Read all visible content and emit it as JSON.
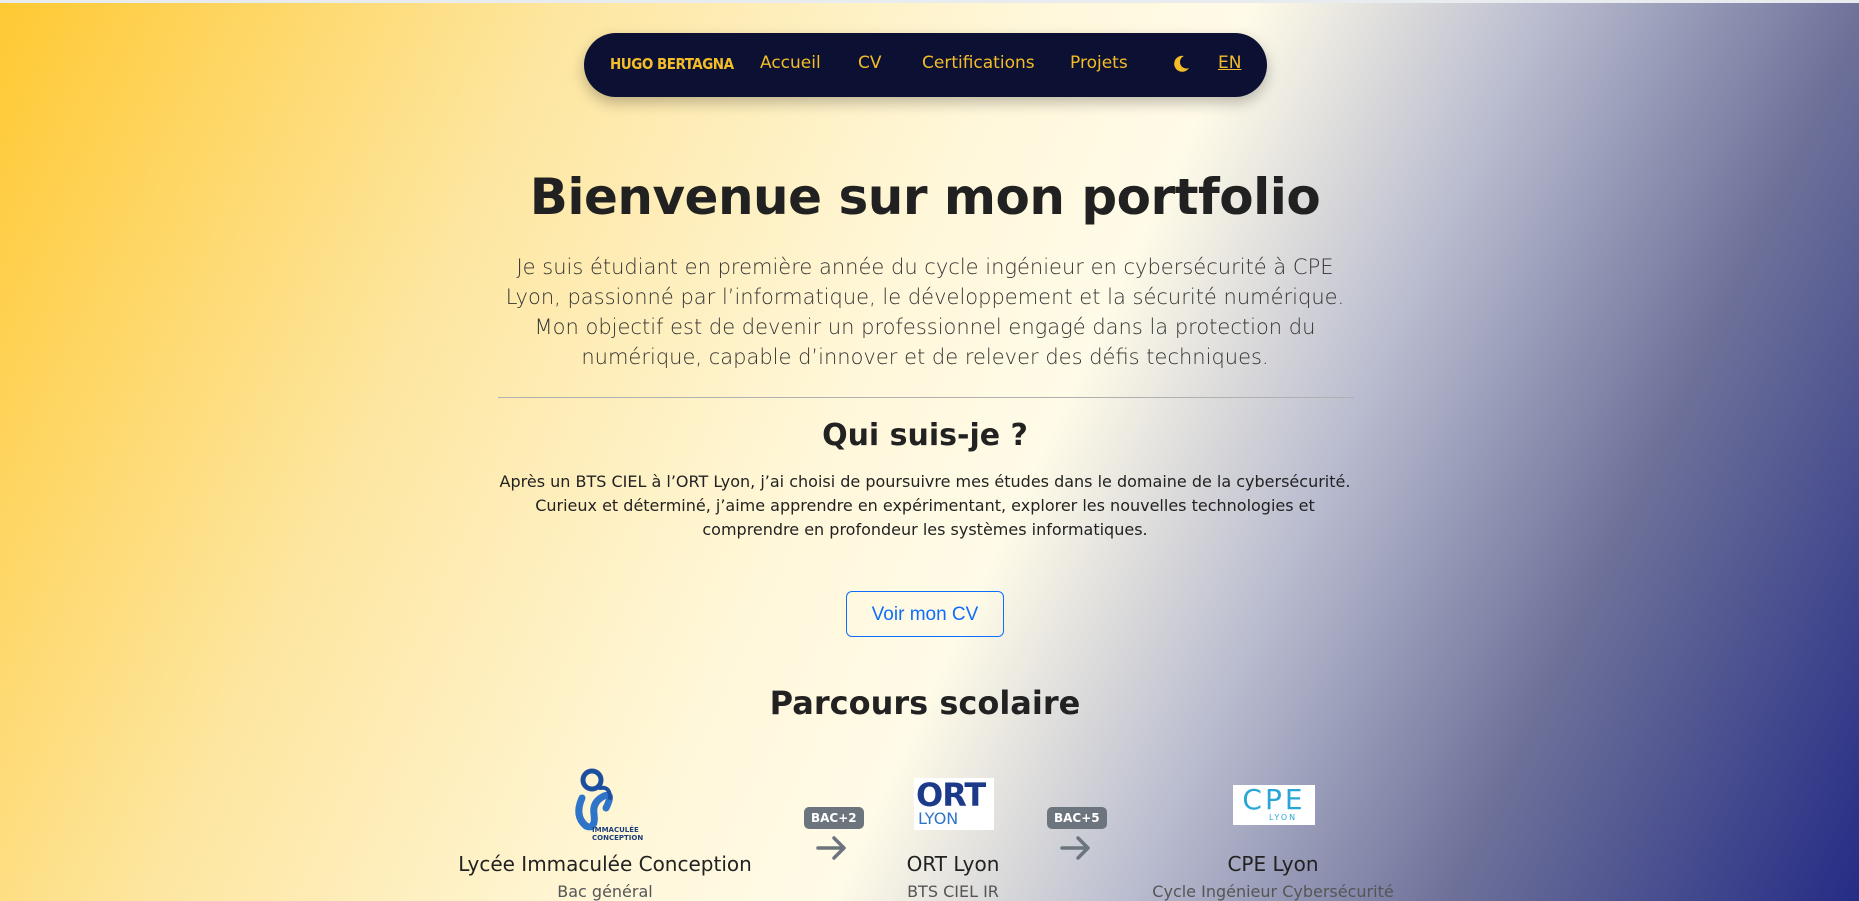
{
  "nav": {
    "brand": "HUGO BERTAGNA",
    "links": [
      "Accueil",
      "CV",
      "Certifications",
      "Projets"
    ],
    "lang": "EN",
    "theme_icon": "moon-icon"
  },
  "hero": {
    "title": "Bienvenue sur mon portfolio",
    "intro": "Je suis étudiant en première année du cycle ingénieur en cybersécurité à CPE Lyon, passionné par l’informatique, le développement et la sécurité numérique. Mon objectif est de devenir un professionnel engagé dans la protection du numérique, capable d’innover et de relever des défis techniques."
  },
  "about": {
    "title": "Qui suis-je ?",
    "text": "Après un BTS CIEL à l’ORT Lyon, j’ai choisi de poursuivre mes études dans le domaine de la cybersécurité. Curieux et déterminé, j’aime apprendre en expérimentant, explorer les nouvelles technologies et comprendre en profondeur les systèmes informatiques.",
    "cv_button": "Voir mon CV"
  },
  "parcours": {
    "title": "Parcours scolaire",
    "schools": [
      {
        "name": "Lycée Immaculée Conception",
        "sub": "Bac général",
        "logo_text": "IMMACULÉE CONCEPTION"
      },
      {
        "name": "ORT Lyon",
        "sub": "BTS CIEL IR",
        "logo_text": "ORT",
        "logo_sub": "LYON"
      },
      {
        "name": "CPE Lyon",
        "sub": "Cycle Ingénieur Cybersécurité",
        "logo_text": "CPE",
        "logo_sub": "LYON"
      }
    ],
    "badges": [
      "BAC+2",
      "BAC+5"
    ]
  },
  "colors": {
    "nav_bg": "#0c1133",
    "nav_text": "#f2bd28",
    "button_blue": "#0d6efd",
    "badge_gray": "#6c757d"
  }
}
